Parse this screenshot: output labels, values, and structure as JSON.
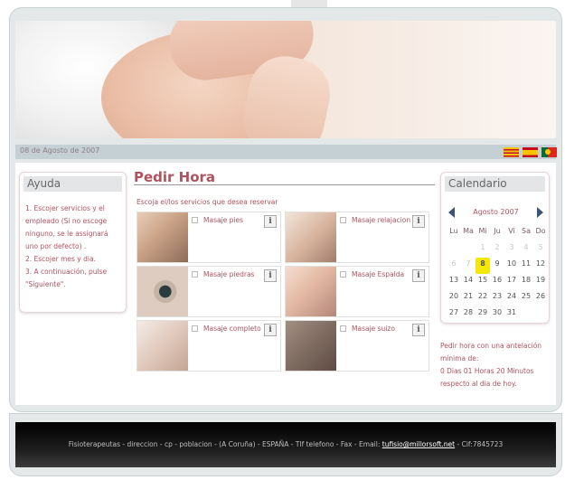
{
  "header": {
    "date": "08 de Agosto de 2007",
    "flags": [
      "catalan-flag-icon",
      "spain-flag-icon",
      "portugal-flag-icon"
    ]
  },
  "help": {
    "title": "Ayuda",
    "lines": [
      "1. Escojer servicios y el empleado (Si no escoge ninguno, se le assignará uno por defecto) .",
      "2. Escojer mes y dia.",
      "3. A continuación, pulse \"Siguiente\"."
    ]
  },
  "main": {
    "title": "Pedir Hora",
    "subtitle": "Escoja el/los servicios que desea reservar",
    "services": [
      {
        "label": "Masaje pies",
        "icon": "info-icon"
      },
      {
        "label": "Masaje relajacion",
        "icon": "info-icon"
      },
      {
        "label": "Masaje piedras",
        "icon": "info-icon"
      },
      {
        "label": "Masaje Espalda",
        "icon": "info-icon"
      },
      {
        "label": "Masaje completo",
        "icon": "info-icon"
      },
      {
        "label": "Masaje suizo",
        "icon": "info-icon"
      }
    ],
    "info_glyph": "i"
  },
  "calendar": {
    "title": "Calendario",
    "month": "Agosto 2007",
    "weekdays": [
      "Lu",
      "Ma",
      "Mi",
      "Ju",
      "Vi",
      "Sa",
      "Do"
    ],
    "weeks": [
      [
        "",
        "",
        "1",
        "2",
        "3",
        "4",
        "5"
      ],
      [
        "6",
        "7",
        "8",
        "9",
        "10",
        "11",
        "12"
      ],
      [
        "13",
        "14",
        "15",
        "16",
        "17",
        "18",
        "19"
      ],
      [
        "20",
        "21",
        "22",
        "23",
        "24",
        "25",
        "26"
      ],
      [
        "27",
        "28",
        "29",
        "30",
        "31",
        "",
        ""
      ]
    ],
    "today": "8",
    "info_lines": [
      "Pedir hora con una antelación mínima de:",
      "0 Dias 01 Horas 20 Minutos",
      "respecto al dia de hoy."
    ]
  },
  "footer": {
    "text_before": "Fisioterapeutas - direccion - cp - poblacion - (A Coruña) - ESPAÑA - Tlf telefono - Fax - Email: ",
    "email": "tufisio@millorsoft.net",
    "text_after": " - Cif:7845723"
  },
  "colors": {
    "accent": "#b0525f",
    "bar": "#c4d0d3",
    "today_highlight": "#f5e800"
  }
}
